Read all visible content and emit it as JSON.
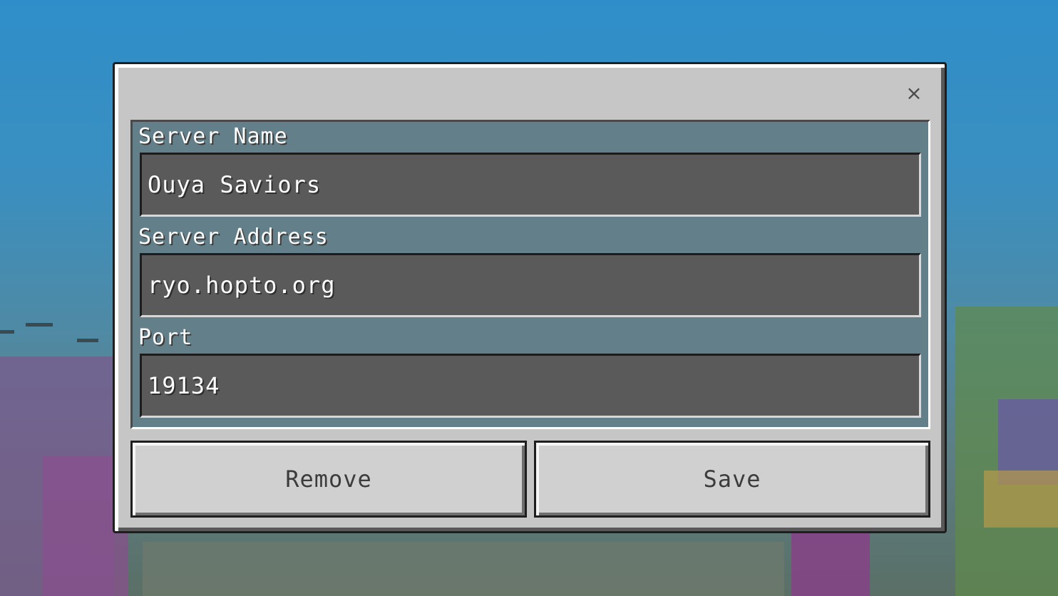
{
  "dialog": {
    "close_symbol": "×"
  },
  "fields": {
    "server_name": {
      "label": "Server Name",
      "value": "Ouya Saviors"
    },
    "server_address": {
      "label": "Server Address",
      "value": "ryo.hopto.org"
    },
    "port": {
      "label": "Port",
      "value": "19134"
    }
  },
  "buttons": {
    "remove_label": "Remove",
    "save_label": "Save"
  },
  "icons": {
    "close": "close-icon"
  },
  "colors": {
    "dialog_bg": "#c6c6c6",
    "panel_bg": "#4a6e7a",
    "input_bg": "#5a5a5a",
    "button_bg": "#d0d0d0",
    "label_text": "#ffffff",
    "button_text": "#3c3c3c"
  }
}
